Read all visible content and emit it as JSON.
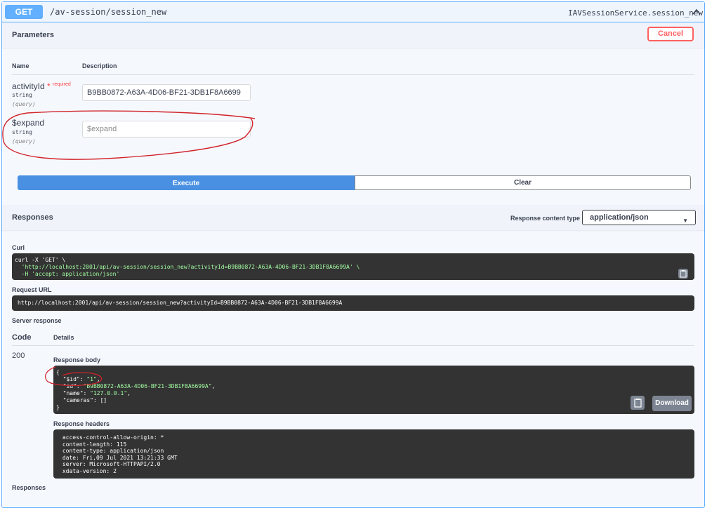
{
  "summary": {
    "method": "GET",
    "path": "/av-session/session_new",
    "operation_id": "IAVSessionService.session_new"
  },
  "parameters": {
    "title": "Parameters",
    "cancel_label": "Cancel",
    "col_name": "Name",
    "col_description": "Description",
    "items": [
      {
        "name": "activityId",
        "required_star": "*",
        "required_label": "required",
        "type": "string",
        "in": "(query)",
        "value": "B9BB0872-A63A-4D06-BF21-3DB1F8A6699",
        "placeholder": ""
      },
      {
        "name": "$expand",
        "type": "string",
        "in": "(query)",
        "value": "",
        "placeholder": "$expand"
      }
    ]
  },
  "actions": {
    "execute_label": "Execute",
    "clear_label": "Clear"
  },
  "responses": {
    "title": "Responses",
    "content_type_label": "Response content type",
    "content_type_value": "application/json",
    "curl_label": "Curl",
    "curl_lines": [
      "curl -X 'GET' \\",
      "  'http://localhost:2001/api/av-session/session_new?activityId=B9BB0872-A63A-4D06-BF21-3DB1F8A6699A' \\",
      "  -H 'accept: application/json'"
    ],
    "request_url_label": "Request URL",
    "request_url": "http://localhost:2001/api/av-session/session_new?activityId=B9BB0872-A63A-4D06-BF21-3DB1F8A6699A",
    "server_response_label": "Server response",
    "code_header": "Code",
    "details_header": "Details",
    "code": "200",
    "body_label": "Response body",
    "body_lines": [
      "{",
      "  \"$id\": \"1\",",
      "  \"id\": \"B9BB0872-A63A-4D06-BF21-3DB1F8A6699A\",",
      "  \"name\": \"127.0.0.1\",",
      "  \"cameras\": []",
      "}"
    ],
    "download_label": "Download",
    "headers_label": "Response headers",
    "header_lines": [
      " access-control-allow-origin: *",
      " content-length: 115",
      " content-type: application/json",
      " date: Fri,09 Jul 2021 13:21:33 GMT",
      " server: Microsoft-HTTPAPI/2.0",
      " xdata-version: 2"
    ],
    "bottom_label": "Responses"
  },
  "colors": {
    "get_blue": "#61affe",
    "execute_blue": "#4990e2",
    "cancel_red": "#ff6060",
    "annotation_red": "#d2232a",
    "code_bg": "#333333",
    "string_green": "#a2fca2"
  },
  "icons": {
    "collapse": "chevron-up-icon",
    "copy": "clipboard-icon",
    "select": "chevron-down-icon"
  }
}
